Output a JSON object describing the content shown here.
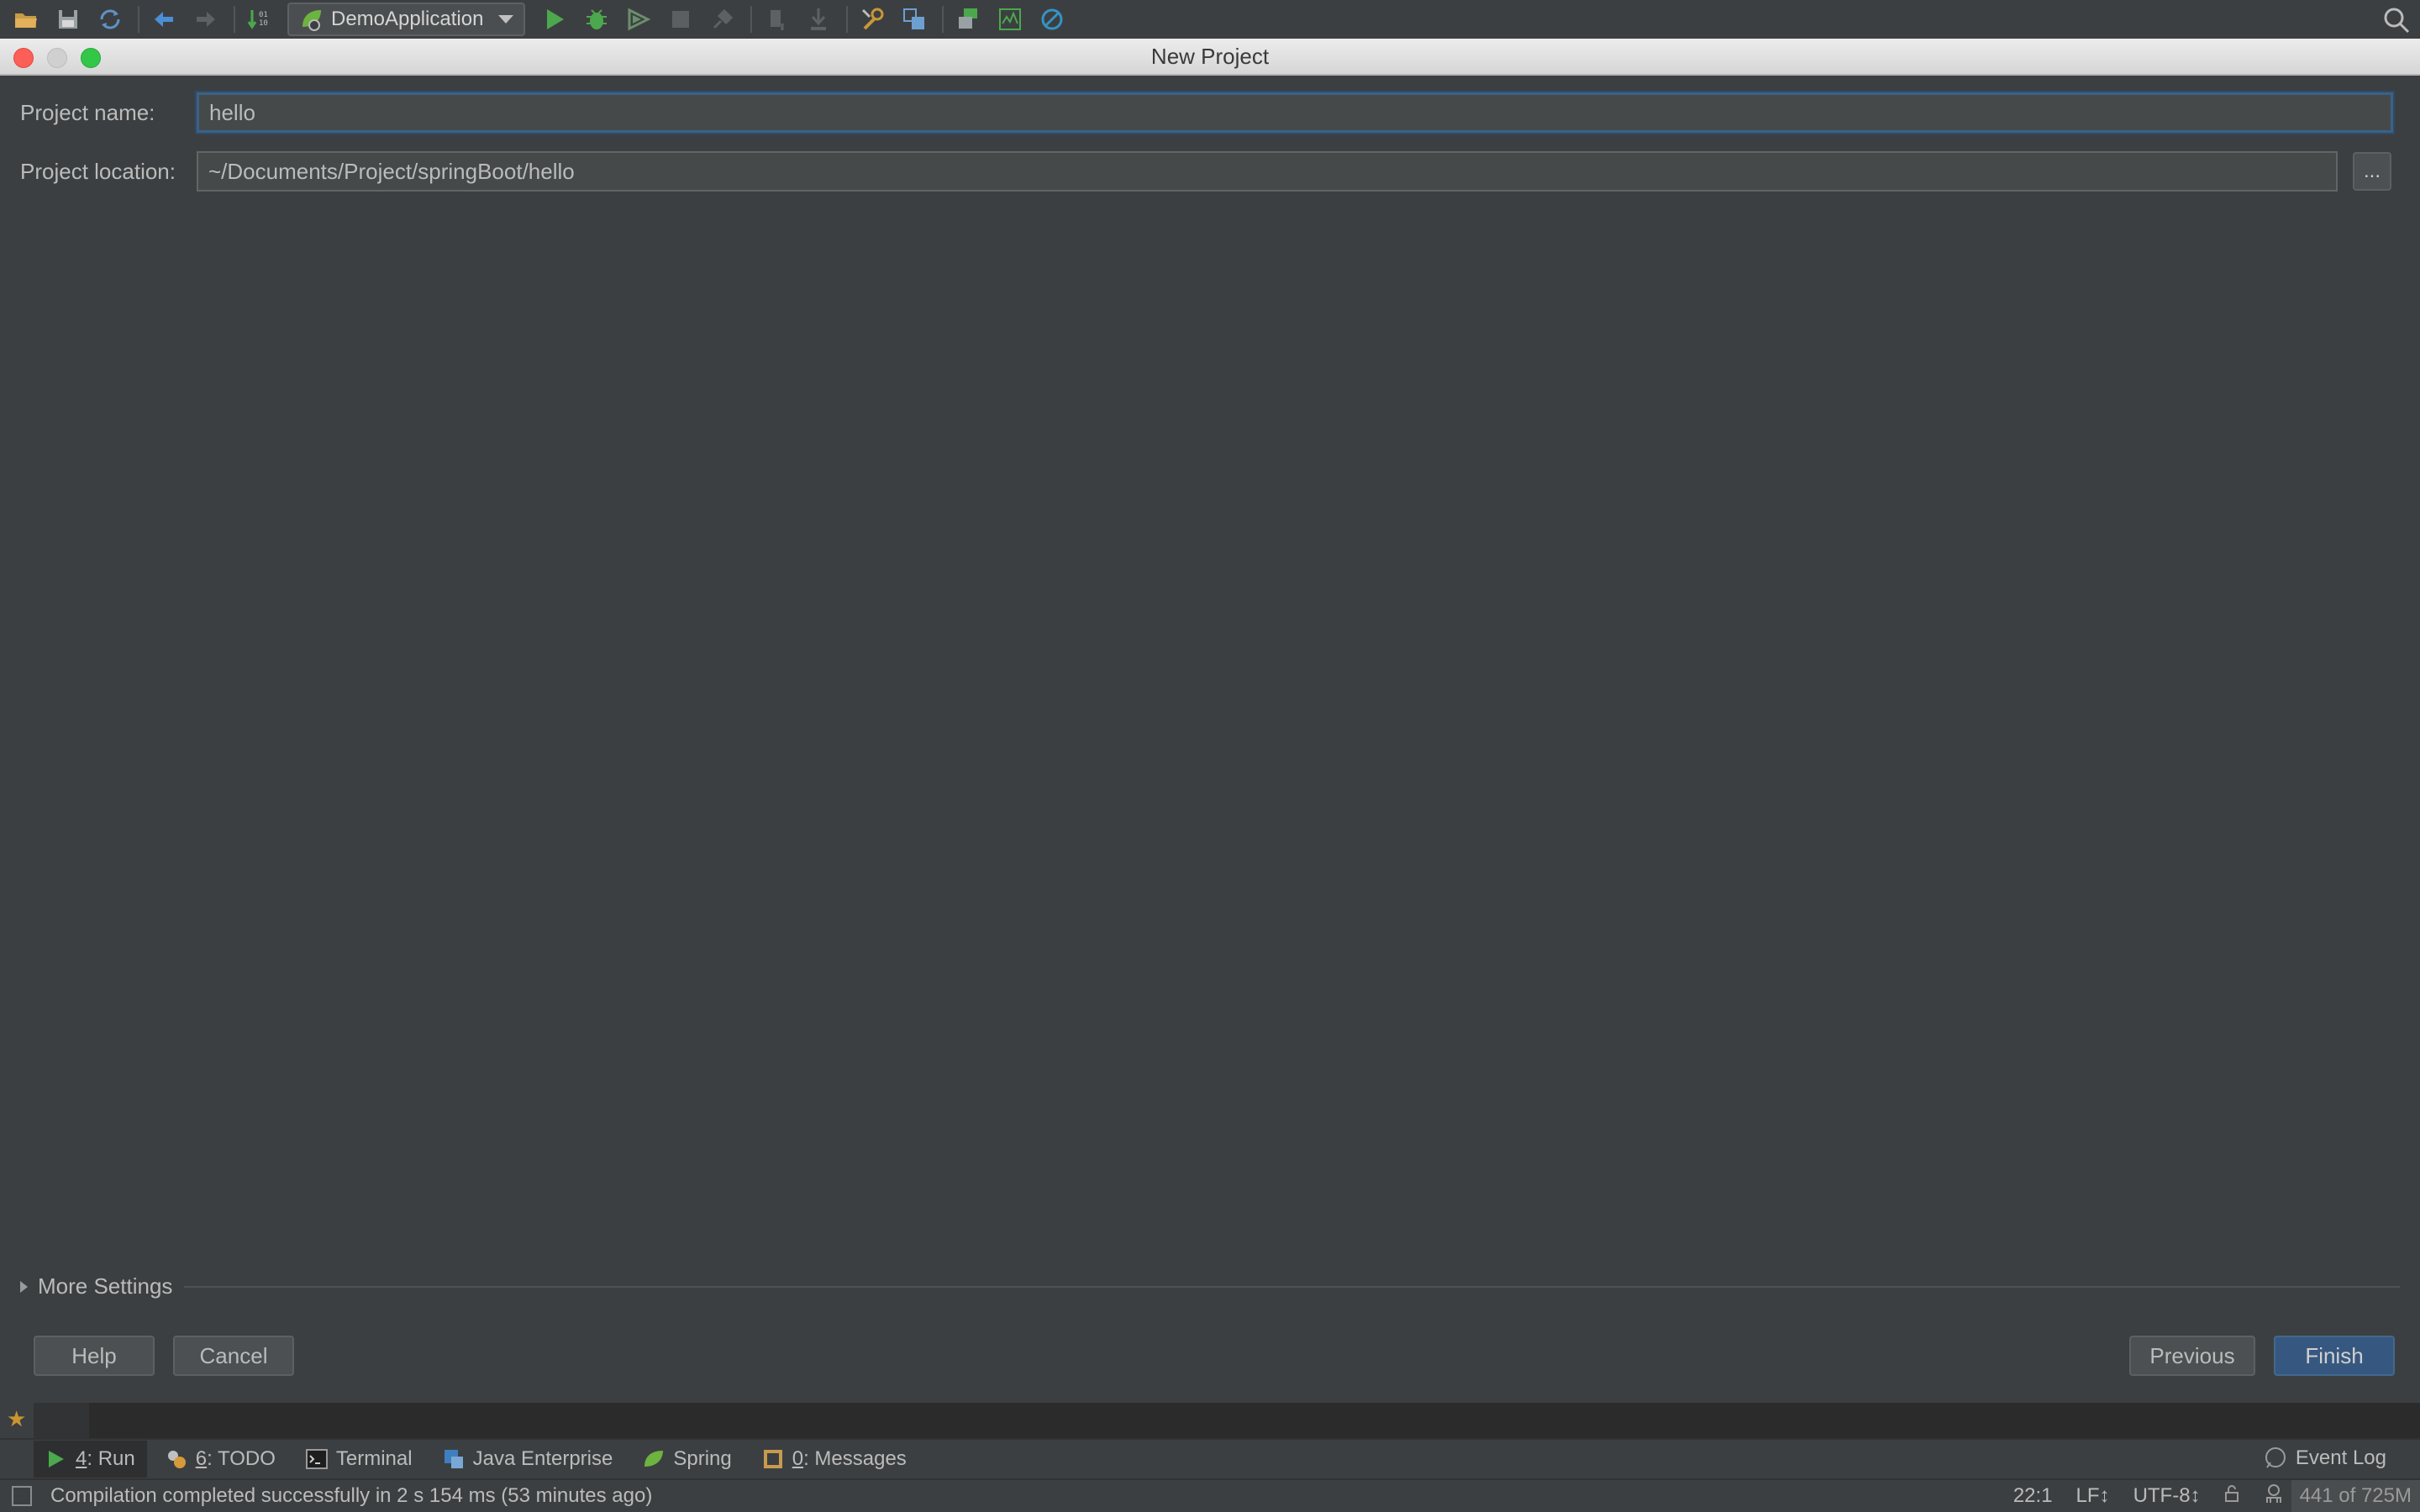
{
  "toolbar": {
    "run_config": "DemoApplication"
  },
  "dialog": {
    "title": "New Project",
    "project_name_label": "Project name:",
    "project_name_value": "hello",
    "project_location_label": "Project location:",
    "project_location_value": "~/Documents/Project/springBoot/hello",
    "browse_label": "...",
    "more_settings_label": "More Settings",
    "help_label": "Help",
    "cancel_label": "Cancel",
    "previous_label": "Previous",
    "finish_label": "Finish"
  },
  "tool_windows": {
    "run": {
      "key": "4",
      "label": ": Run"
    },
    "todo": {
      "key": "6",
      "label": ": TODO"
    },
    "terminal": {
      "label": "Terminal"
    },
    "java_enterprise": {
      "label": "Java Enterprise"
    },
    "spring": {
      "label": "Spring"
    },
    "messages": {
      "key": "0",
      "label": ": Messages"
    },
    "event_log": {
      "label": "Event Log"
    }
  },
  "status": {
    "message": "Compilation completed successfully in 2 s 154 ms (53 minutes ago)",
    "position": "22:1",
    "line_separator": "LF↕",
    "encoding": "UTF-8↕",
    "memory": "441 of 725M"
  },
  "colors": {
    "background": "#3c3f41",
    "accent_finish": "#365880",
    "focus_border": "#3d6185",
    "run_green": "#4ca84d"
  }
}
